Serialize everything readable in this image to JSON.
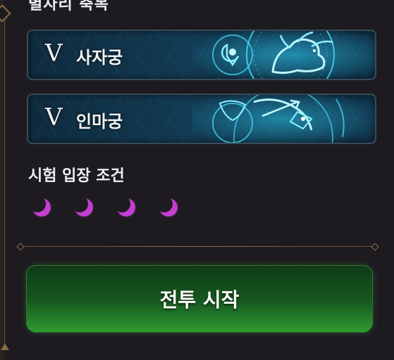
{
  "section_title": "별자리 축복",
  "blessings": [
    {
      "rank": "V",
      "name": "사자궁",
      "icon": "leo-constellation-icon"
    },
    {
      "rank": "V",
      "name": "인마궁",
      "icon": "sagittarius-constellation-icon"
    }
  ],
  "entry": {
    "title": "시험 입장 조건",
    "moon_count": 4,
    "moon_color": "#c23fd0"
  },
  "start_button": {
    "label": "전투 시작"
  }
}
